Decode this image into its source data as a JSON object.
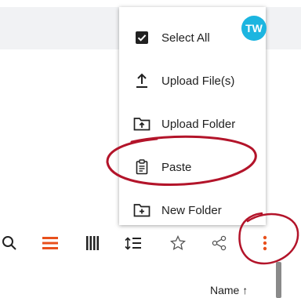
{
  "avatar": {
    "initials": "TW"
  },
  "menu": {
    "items": [
      {
        "label": "Select All",
        "icon": "checkbox-checked-icon"
      },
      {
        "label": "Upload File(s)",
        "icon": "upload-icon"
      },
      {
        "label": "Upload Folder",
        "icon": "folder-upload-icon"
      },
      {
        "label": "Paste",
        "icon": "clipboard-icon"
      },
      {
        "label": "New Folder",
        "icon": "folder-plus-icon"
      }
    ]
  },
  "toolbar": {
    "icons": [
      "search-icon",
      "list-view-icon",
      "column-view-icon",
      "sort-icon",
      "star-icon",
      "share-icon",
      "more-vertical-icon"
    ],
    "active_color": "#e8501c"
  },
  "list": {
    "sort_label": "Name ↑"
  },
  "colors": {
    "accent": "#e8501c",
    "annotation": "#b3142a",
    "avatar_bg": "#1cb5e0"
  }
}
